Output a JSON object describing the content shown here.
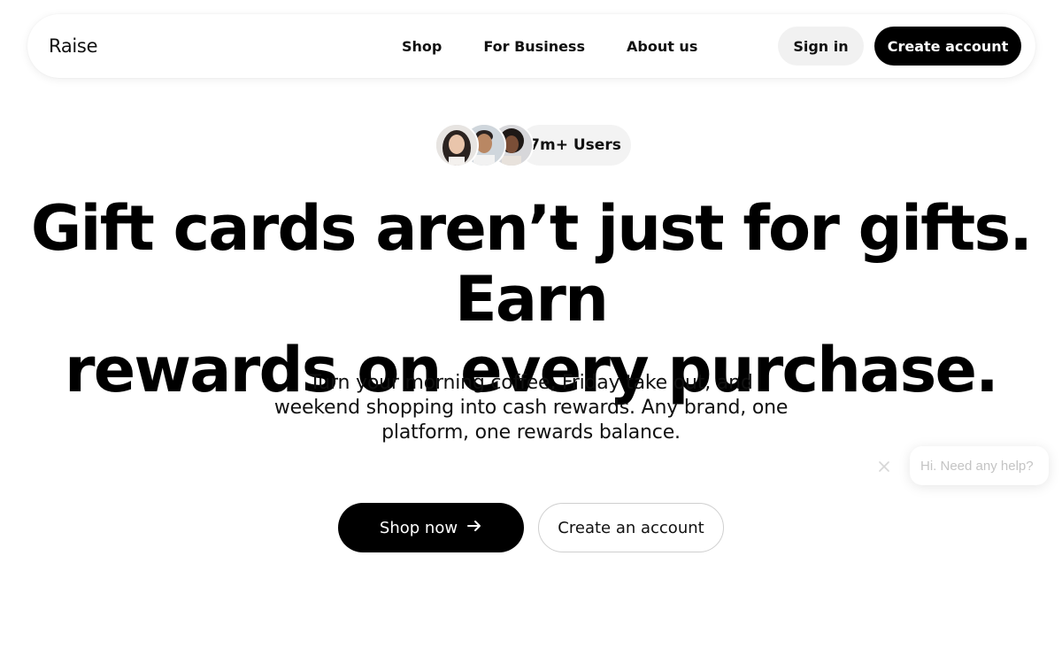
{
  "header": {
    "logo": "Raise",
    "nav": [
      {
        "label": "Shop"
      },
      {
        "label": "For Business"
      },
      {
        "label": "About us"
      }
    ],
    "sign_in_label": "Sign in",
    "create_account_label": "Create account"
  },
  "hero": {
    "users_label": "7m+ Users",
    "headline_line1": "Gift cards aren’t just for gifts. Earn",
    "headline_line2": "rewards on every purchase.",
    "subtext": "Turn your morning coffee, Friday take out, and weekend shopping into cash rewards. Any brand, one platform, one rewards balance.",
    "primary_cta": "Shop now",
    "secondary_cta": "Create an account"
  },
  "chat": {
    "prompt": "Hi. Need any help?"
  },
  "colors": {
    "primary": "#000000",
    "pill_bg": "#f1f1f1",
    "chat_text": "#c4c4c4"
  },
  "icons": [
    "arrow-right-icon",
    "close-icon"
  ]
}
